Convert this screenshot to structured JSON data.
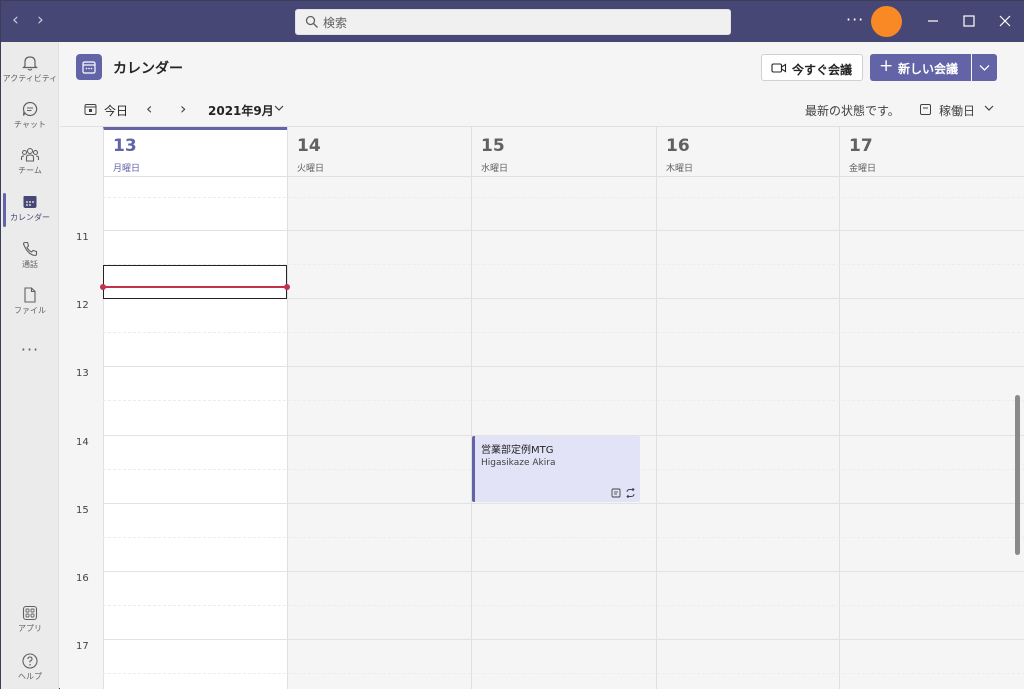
{
  "titlebar": {
    "search_placeholder": "検索",
    "more_label": "···"
  },
  "rail": {
    "items": [
      {
        "label": "アクティビティ"
      },
      {
        "label": "チャット"
      },
      {
        "label": "チーム"
      },
      {
        "label": "カレンダー"
      },
      {
        "label": "通話"
      },
      {
        "label": "ファイル"
      }
    ],
    "more_label": "···",
    "apps_label": "アプリ",
    "help_label": "ヘルプ"
  },
  "header": {
    "title": "カレンダー",
    "meet_now_label": "今すぐ会議",
    "new_meeting_label": "新しい会議"
  },
  "toolbar": {
    "today_label": "今日",
    "month_label": "2021年9月",
    "status_label": "最新の状態です。",
    "view_label": "稼働日"
  },
  "calendar": {
    "days": [
      {
        "num": "13",
        "name": "月曜日"
      },
      {
        "num": "14",
        "name": "火曜日"
      },
      {
        "num": "15",
        "name": "水曜日"
      },
      {
        "num": "16",
        "name": "木曜日"
      },
      {
        "num": "17",
        "name": "金曜日"
      }
    ],
    "hours": [
      "11",
      "12",
      "13",
      "14",
      "15",
      "16",
      "17"
    ],
    "event": {
      "title": "営業部定例MTG",
      "organizer": "Higasikaze Akira"
    }
  },
  "colors": {
    "titlebar": "#464775",
    "accent": "#6264a7",
    "avatar": "#f98925",
    "now_line": "#c4314b",
    "event_bg": "#e3e3f7"
  }
}
